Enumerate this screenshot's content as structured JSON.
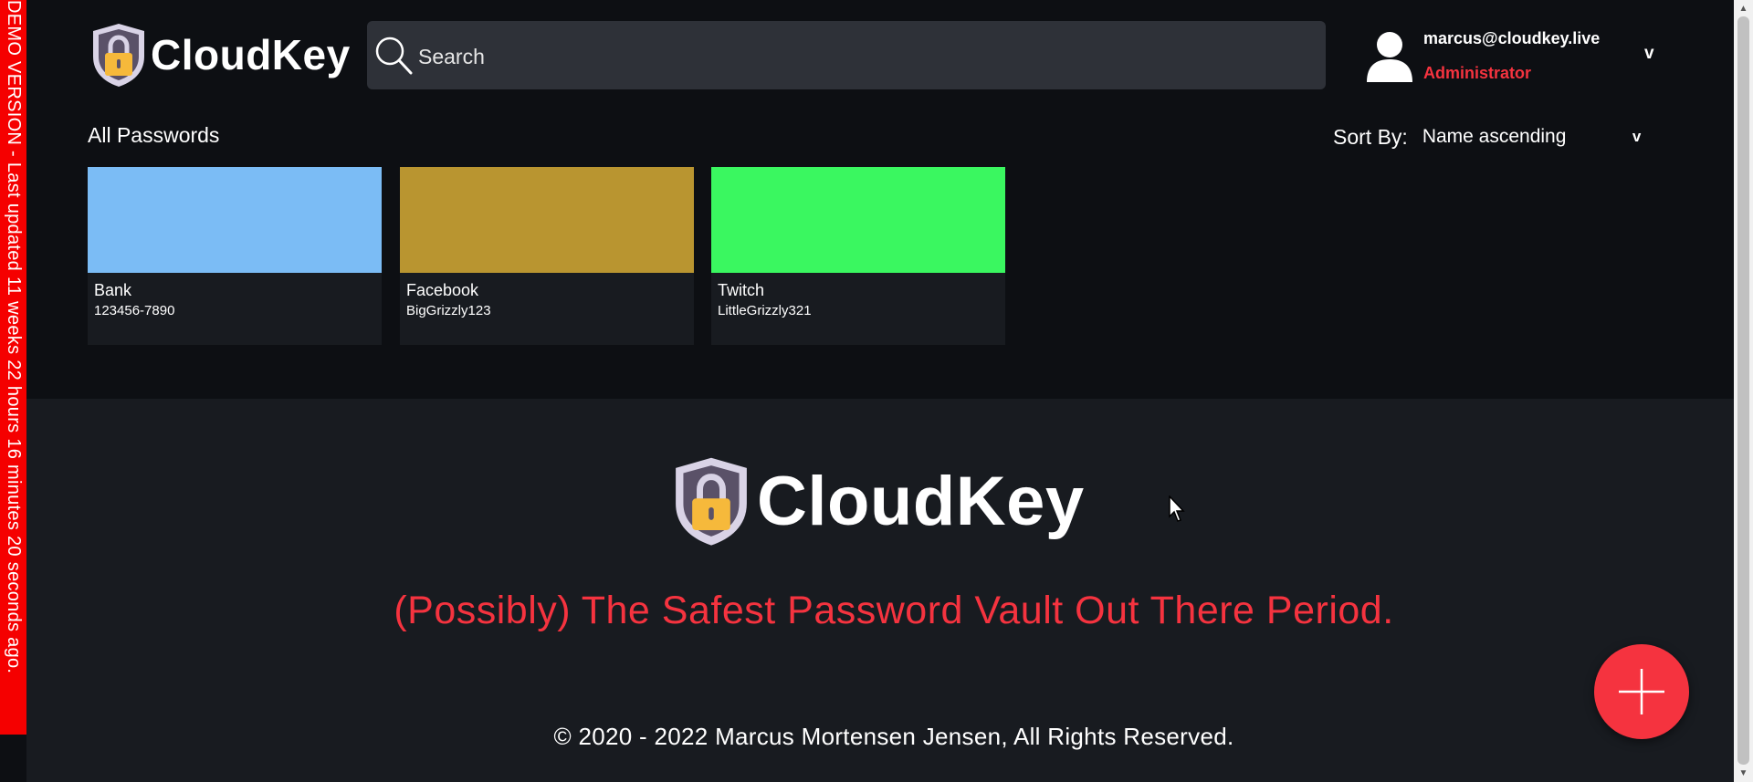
{
  "demo_banner": {
    "text": "DEMO VERSION - Last updated 11 weeks 22 hours 16 minutes 20 seconds ago."
  },
  "header": {
    "logo_text": "CloudKey",
    "search": {
      "placeholder": "Search",
      "value": "",
      "icon": "search-icon"
    },
    "user": {
      "email": "marcus@cloudkey.live",
      "role": "Administrator",
      "menu_indicator": "v",
      "icon": "user-avatar-icon"
    }
  },
  "list": {
    "title": "All Passwords",
    "sort": {
      "label": "Sort By:",
      "selected": "Name ascending",
      "indicator": "v"
    }
  },
  "cards": [
    {
      "name": "Bank",
      "username": "123456-7890",
      "color": "#7bbcf5"
    },
    {
      "name": "Facebook",
      "username": "BigGrizzly123",
      "color": "#b99530"
    },
    {
      "name": "Twitch",
      "username": "LittleGrizzly321",
      "color": "#3af760"
    }
  ],
  "footer": {
    "logo_text": "CloudKey",
    "tagline": "(Possibly) The Safest Password Vault Out There Period.",
    "copyright": "© 2020 - 2022 Marcus Mortensen Jensen, All Rights Reserved."
  },
  "fab": {
    "icon": "plus-icon"
  },
  "colors": {
    "background": "#0d0f13",
    "surface": "#181b20",
    "search_bg": "#2e3138",
    "accent": "#f5333f",
    "banner": "#f50000"
  }
}
